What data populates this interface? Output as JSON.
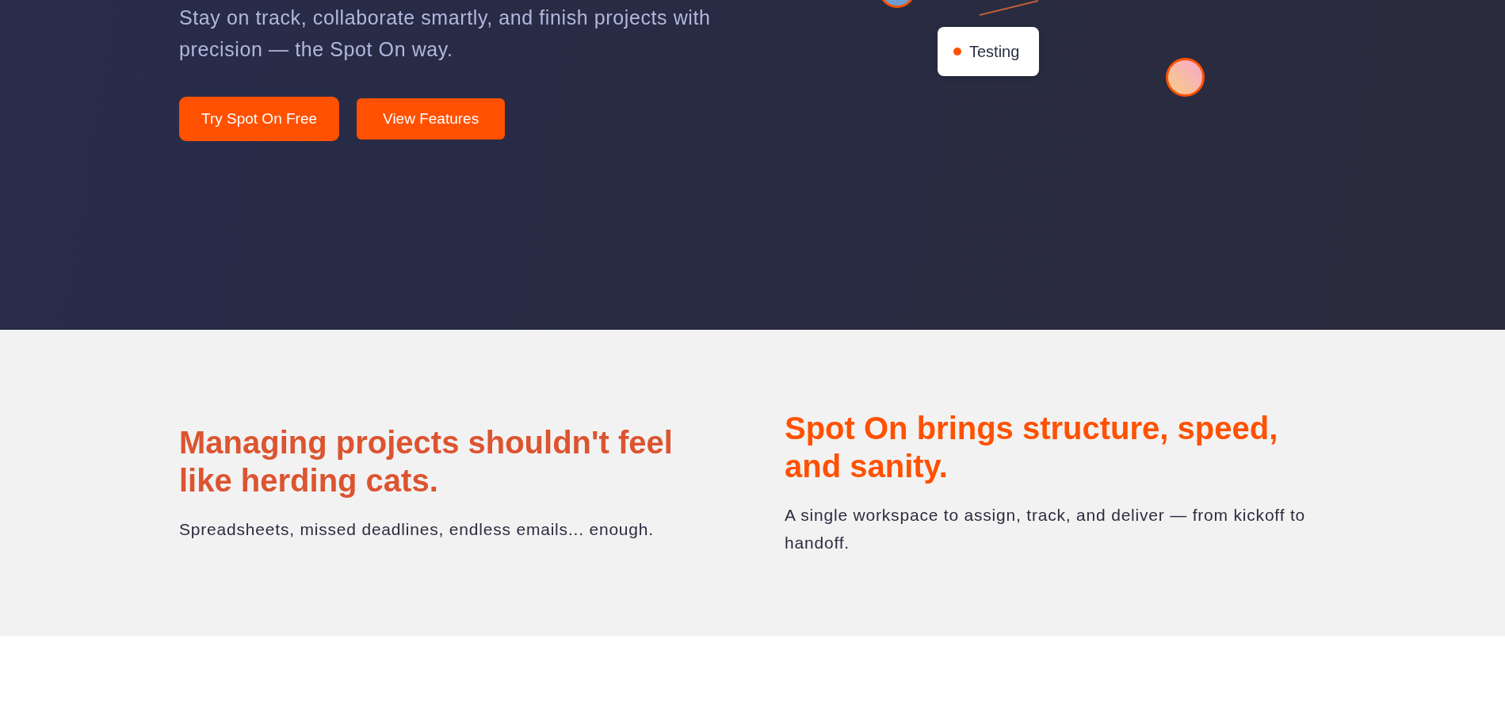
{
  "hero": {
    "subtitle": "Stay on track, collaborate smartly, and finish projects with precision — the Spot On way.",
    "buttons": [
      {
        "label": "Try Spot On Free",
        "hovered": true
      },
      {
        "label": "View Features",
        "hovered": false
      }
    ],
    "status_tag": {
      "label": "Testing"
    }
  },
  "pitch": [
    {
      "kind": "problem",
      "heading": "Managing projects shouldn't feel like herding cats.",
      "text": "Spreadsheets, missed deadlines, endless emails... enough."
    },
    {
      "kind": "solution",
      "heading": "Spot On brings structure, speed, and sanity.",
      "text": "A single workspace to assign, track, and deliver — from kickoff to handoff."
    }
  ]
}
